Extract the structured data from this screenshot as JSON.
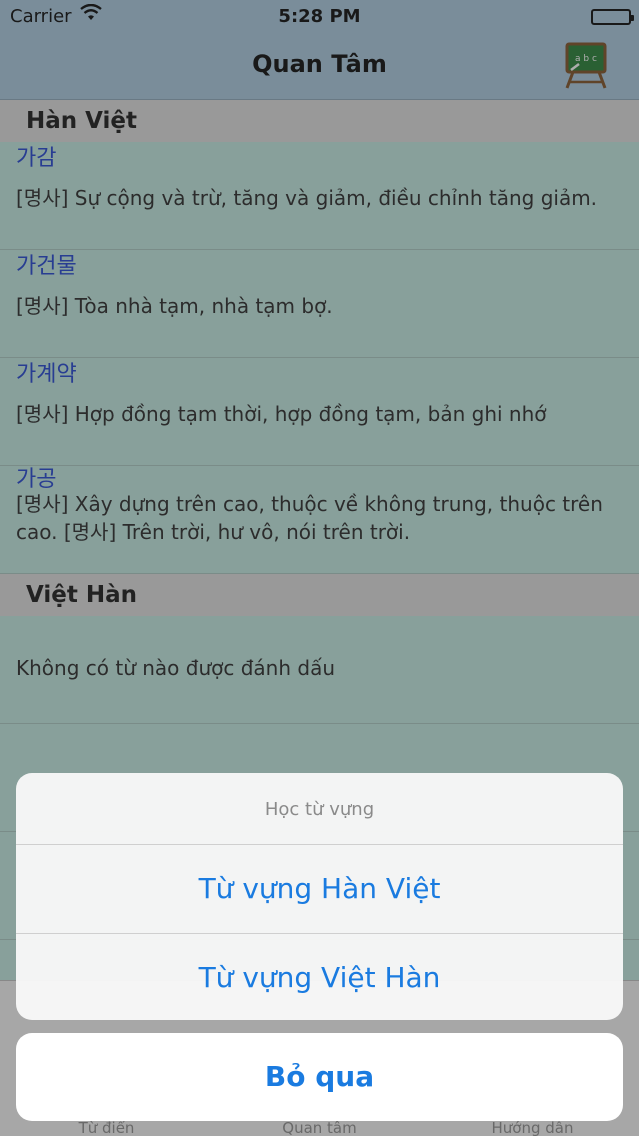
{
  "status_bar": {
    "carrier": "Carrier",
    "time": "5:28 PM"
  },
  "nav": {
    "title": "Quan Tâm",
    "board_icon_text": "a b c"
  },
  "sections": [
    {
      "header": "Hàn Việt",
      "rows": [
        {
          "word": "가감",
          "meaning": "[명사] Sự cộng và trừ, tăng và giảm, điều chỉnh tăng giảm."
        },
        {
          "word": "가건물",
          "meaning": "[명사] Tòa nhà tạm, nhà tạm bợ."
        },
        {
          "word": "가계약",
          "meaning": "[명사] Hợp đồng tạm thời, hợp đồng tạm, bản ghi nhớ"
        },
        {
          "word": "가공",
          "meaning": "[명사] Xây dựng trên cao, thuộc về không trung, thuộc trên cao. [명사] Trên trời, hư vô, nói trên trời."
        }
      ]
    },
    {
      "header": "Việt Hàn",
      "empty_text": "Không có từ nào được đánh dấu"
    }
  ],
  "tabs": [
    {
      "label": "Từ điển"
    },
    {
      "label": "Quan tâm"
    },
    {
      "label": "Hướng dẫn"
    }
  ],
  "action_sheet": {
    "title": "Học từ vựng",
    "actions": [
      "Từ vựng Hàn Việt",
      "Từ vựng Việt Hàn"
    ],
    "cancel": "Bỏ qua"
  },
  "colors": {
    "accent": "#1a7be0",
    "word": "#1a3fd0",
    "navbar": "#a8c9df",
    "list_bg": "#bfe8e0"
  }
}
